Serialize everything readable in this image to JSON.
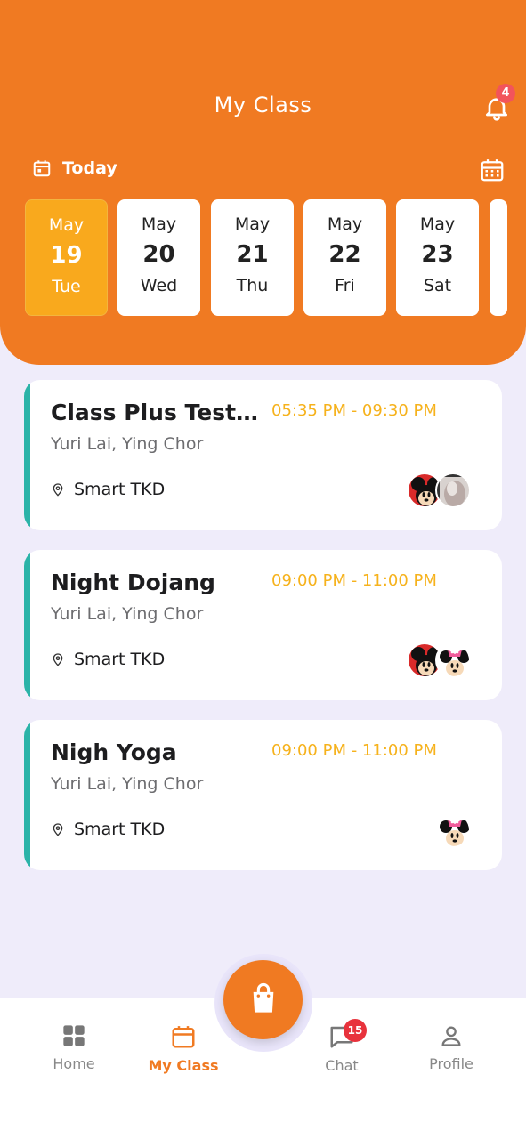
{
  "header": {
    "title": "My Class",
    "notification_count": "4",
    "today_label": "Today"
  },
  "days": [
    {
      "month": "May",
      "day": "19",
      "weekday": "Tue",
      "selected": true
    },
    {
      "month": "May",
      "day": "20",
      "weekday": "Wed",
      "selected": false
    },
    {
      "month": "May",
      "day": "21",
      "weekday": "Thu",
      "selected": false
    },
    {
      "month": "May",
      "day": "22",
      "weekday": "Fri",
      "selected": false
    },
    {
      "month": "May",
      "day": "23",
      "weekday": "Sat",
      "selected": false
    }
  ],
  "classes": [
    {
      "name": "Class Plus Testi...",
      "time": "05:35 PM - 09:30 PM",
      "instructors": "Yuri Lai, Ying Chor",
      "location": "Smart TKD"
    },
    {
      "name": "Night Dojang",
      "time": "09:00 PM - 11:00 PM",
      "instructors": "Yuri Lai, Ying Chor",
      "location": "Smart TKD"
    },
    {
      "name": "Nigh Yoga",
      "time": "09:00 PM - 11:00 PM",
      "instructors": "Yuri Lai, Ying Chor",
      "location": "Smart TKD"
    }
  ],
  "nav": {
    "home": "Home",
    "my_class": "My Class",
    "chat": "Chat",
    "chat_badge": "15",
    "profile": "Profile"
  },
  "colors": {
    "primary": "#f07a22",
    "selected_day": "#f9a91d",
    "time_text": "#f6b21c",
    "card_accent": "#2bb3a8",
    "page_bg": "#efecfa"
  },
  "icons": [
    "bell-icon",
    "calendar-today-icon",
    "calendar-grid-icon",
    "location-pin-icon",
    "home-grid-icon",
    "calendar-icon",
    "chat-bubble-icon",
    "person-icon",
    "shopping-bag-icon"
  ]
}
